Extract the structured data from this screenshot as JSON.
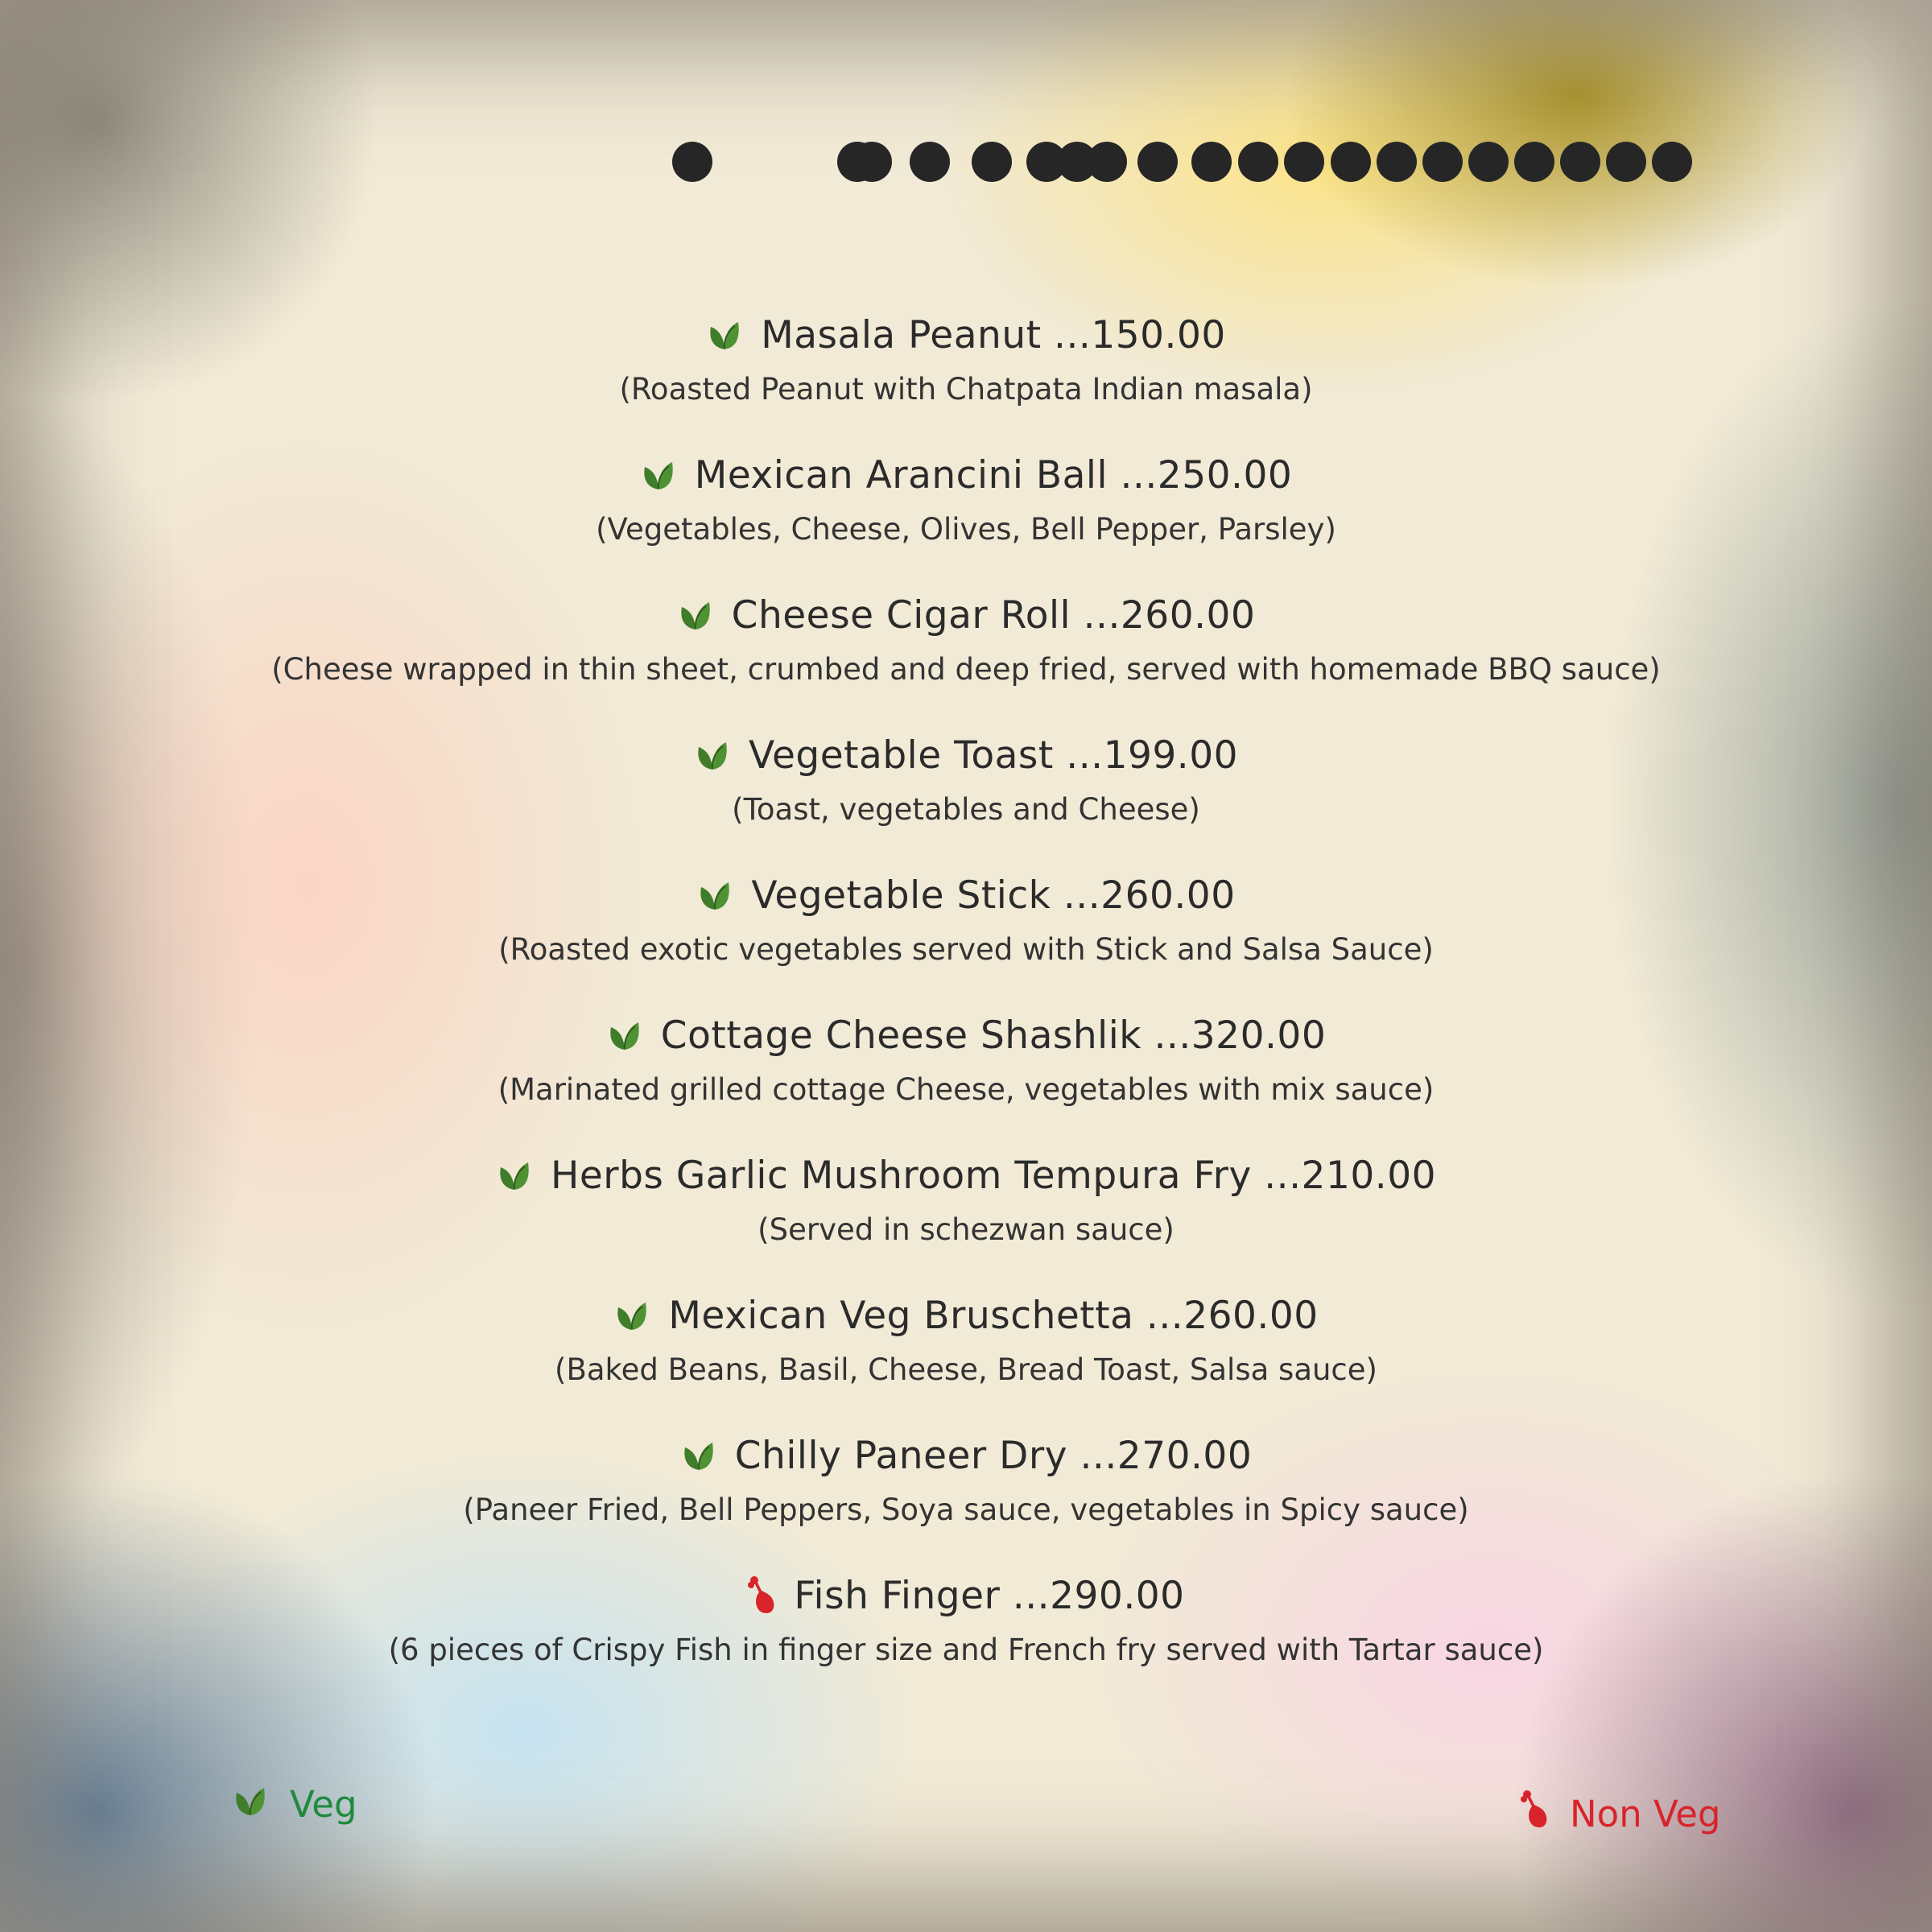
{
  "menu": {
    "items": [
      {
        "type": "veg",
        "name": "Masala Peanut",
        "price": "...150.00",
        "description": "(Roasted Peanut with Chatpata Indian masala)"
      },
      {
        "type": "veg",
        "name": "Mexican Arancini Ball",
        "price": "...250.00",
        "description": "(Vegetables, Cheese, Olives, Bell Pepper, Parsley)"
      },
      {
        "type": "veg",
        "name": "Cheese Cigar Roll",
        "price": "...260.00",
        "description": "(Cheese wrapped in thin sheet, crumbed and deep fried, served with homemade BBQ sauce)"
      },
      {
        "type": "veg",
        "name": "Vegetable Toast",
        "price": "...199.00",
        "description": "(Toast, vegetables and Cheese)"
      },
      {
        "type": "veg",
        "name": "Vegetable Stick",
        "price": "...260.00",
        "description": "(Roasted exotic vegetables served with Stick and Salsa Sauce)"
      },
      {
        "type": "veg",
        "name": "Cottage Cheese Shashlik",
        "price": "...320.00",
        "description": "(Marinated grilled cottage Cheese, vegetables with mix sauce)"
      },
      {
        "type": "veg",
        "name": "Herbs Garlic Mushroom Tempura Fry",
        "price": "...210.00",
        "description": "(Served in schezwan sauce)"
      },
      {
        "type": "veg",
        "name": "Mexican Veg Bruschetta",
        "price": "...260.00",
        "description": "(Baked Beans, Basil, Cheese, Bread Toast, Salsa sauce)"
      },
      {
        "type": "veg",
        "name": "Chilly Paneer Dry",
        "price": "...270.00",
        "description": "(Paneer Fried, Bell Peppers, Soya sauce, vegetables in Spicy sauce)"
      },
      {
        "type": "non-veg",
        "name": "Fish Finger",
        "price": "...290.00",
        "description": "(6 pieces of Crispy Fish in finger size and French fry served with Tartar sauce)"
      }
    ]
  },
  "legend": {
    "veg_label": "Veg",
    "nonveg_label": "Non Veg",
    "veg_icon": "leaf-icon",
    "nonveg_icon": "drumstick-icon"
  },
  "colors": {
    "veg_green": "#1f8a3f",
    "leaf_green": "#3f7d2a",
    "nonveg_red": "#d8232a",
    "text": "#2b2b2b"
  }
}
